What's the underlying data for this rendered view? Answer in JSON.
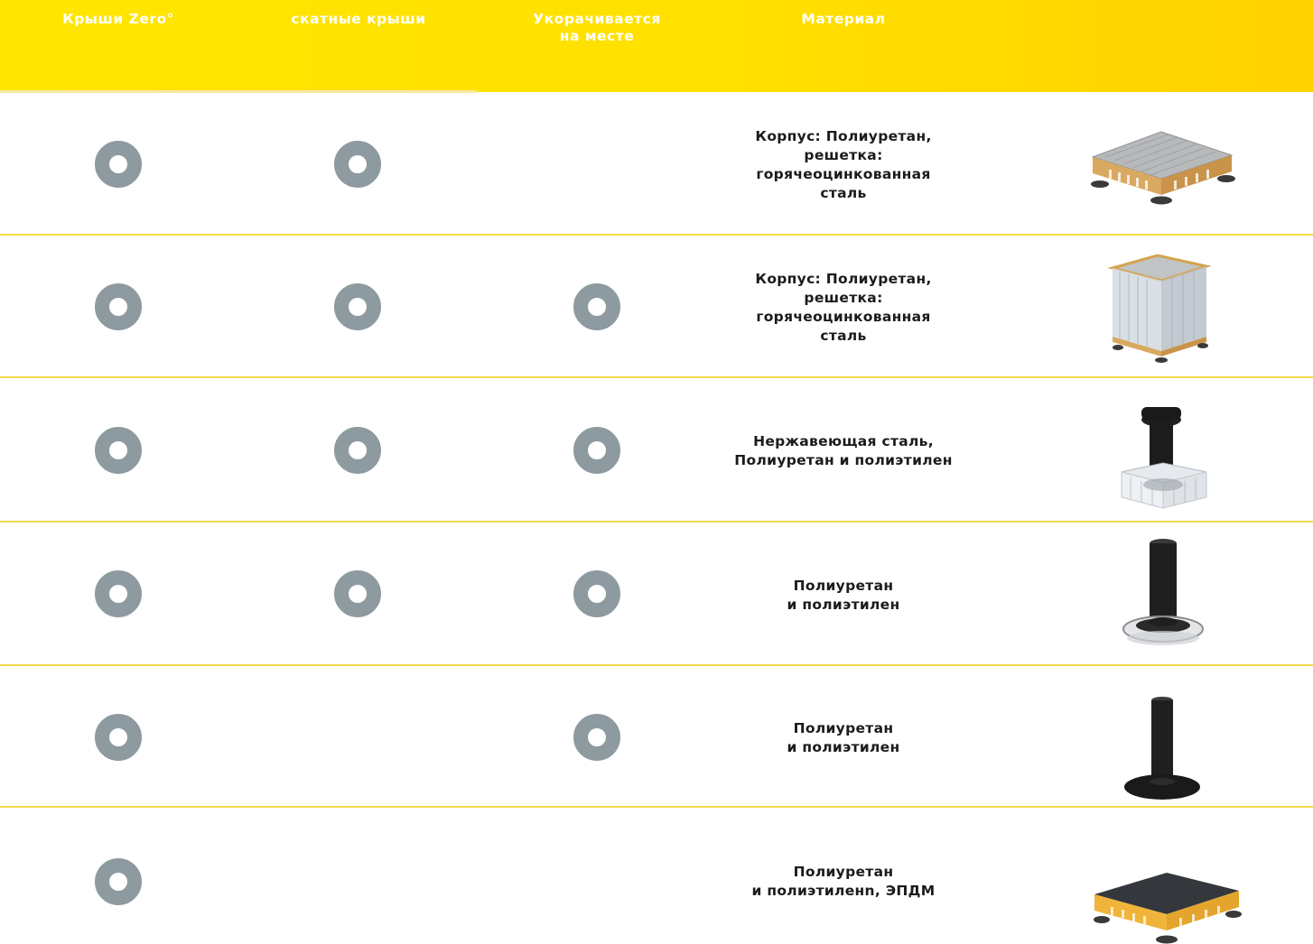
{
  "header": {
    "col1": "Крыши Zero°",
    "col2": "скатные крыши",
    "col3_line1": "Укорачивается",
    "col3_line2": "на месте",
    "col4": "Материал"
  },
  "colors": {
    "header_bg": "#ffe400",
    "divider": "#f3d94c",
    "ring": "#8d9aa0",
    "header_text": "#ffffff"
  },
  "rows": [
    {
      "zero_roof": true,
      "pitched_roof": true,
      "shortenable": false,
      "material": [
        "Корпус: Полиуретан,",
        "решетка:",
        "горячеоцинкованная",
        "сталь"
      ],
      "image": "grate-box-icon"
    },
    {
      "zero_roof": true,
      "pitched_roof": true,
      "shortenable": true,
      "material": [
        "Корпус: Полиуретан,",
        "решетка:",
        "горячеоцинкованная",
        "сталь"
      ],
      "image": "tall-grate-box-icon"
    },
    {
      "zero_roof": true,
      "pitched_roof": true,
      "shortenable": true,
      "material": [
        "Нержавеющая сталь,",
        "Полиуретан и полиэтилен"
      ],
      "image": "vent-pipe-box-icon"
    },
    {
      "zero_roof": true,
      "pitched_roof": true,
      "shortenable": true,
      "material": [
        "Полиуретан",
        "и полиэтилен"
      ],
      "image": "pipe-clamp-flange-icon"
    },
    {
      "zero_roof": true,
      "pitched_roof": false,
      "shortenable": true,
      "material": [
        "Полиуретан",
        "и полиэтилен"
      ],
      "image": "pipe-flange-icon"
    },
    {
      "zero_roof": true,
      "pitched_roof": false,
      "shortenable": false,
      "material": [
        "Полиуретан",
        "и полиэтиленn, ЭПДМ"
      ],
      "image": "membrane-box-icon"
    }
  ]
}
